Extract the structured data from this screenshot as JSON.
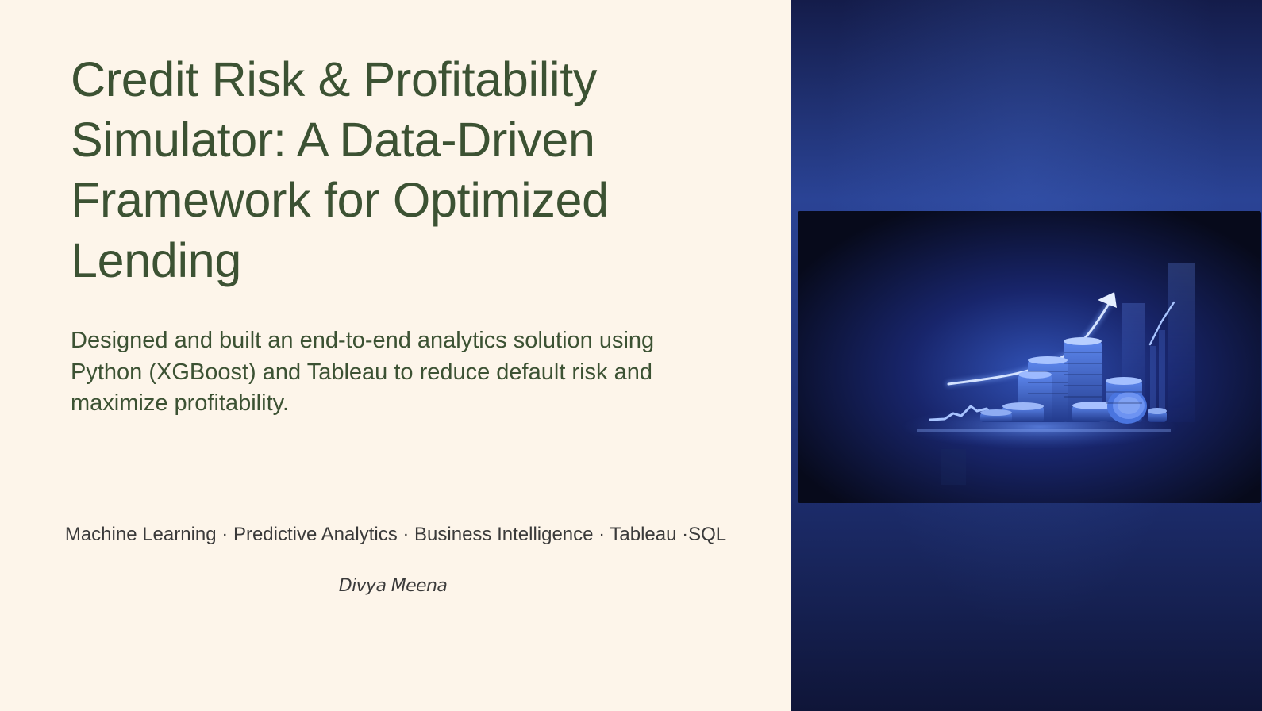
{
  "slide": {
    "title": "Credit Risk & Profitability Simulator: A Data-Driven Framework for Optimized Lending",
    "subtitle": "Designed and built an end-to-end analytics solution using Python (XGBoost) and Tableau to reduce default risk and maximize profitability.",
    "tags": "Machine Learning · Predictive Analytics · Business Intelligence · Tableau ·SQL",
    "author": "Divya Meena"
  },
  "image": {
    "icon": "finance-growth-coins-chart-icon",
    "alt": "Glowing stacks of coins with a rising growth arrow"
  },
  "colors": {
    "background": "#fdf5ea",
    "title_text": "#3c5233",
    "body_text": "#3a3a3a",
    "panel_top": "#141c4a",
    "panel_mid": "#2a4395",
    "panel_bottom": "#0f1538",
    "glow": "#5f8fff"
  }
}
